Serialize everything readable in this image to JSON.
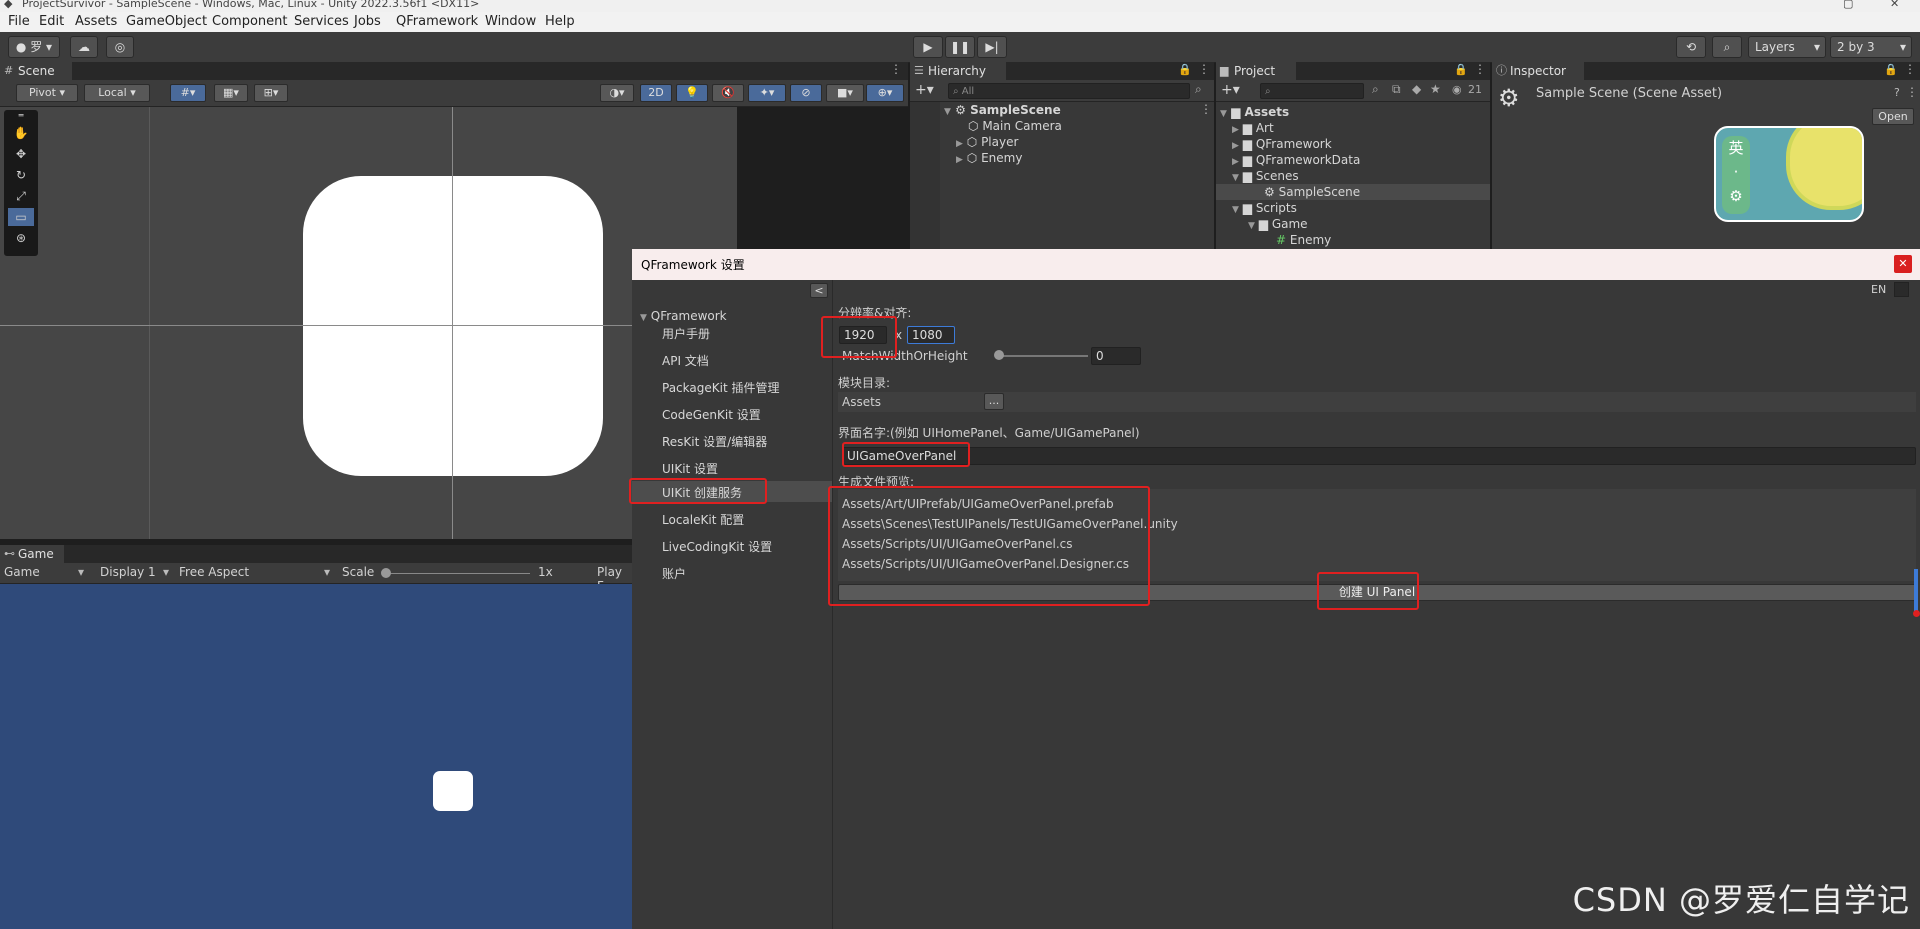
{
  "window": {
    "title": "ProjectSurvivor - SampleScene - Windows, Mac, Linux - Unity 2022.3.56f1 <DX11>"
  },
  "menu": [
    "File",
    "Edit",
    "Assets",
    "GameObject",
    "Component",
    "Services",
    "Jobs",
    "QFramework",
    "Window",
    "Help"
  ],
  "toolbar": {
    "account": "罗",
    "layers_label": "Layers",
    "layout_label": "2 by 3"
  },
  "scene": {
    "tab": "Scene",
    "pivot": "Pivot",
    "local": "Local",
    "mode_2d": "2D"
  },
  "game": {
    "tab": "Game",
    "display_mode": "Game",
    "display": "Display 1",
    "aspect": "Free Aspect",
    "scale_label": "Scale",
    "scale_value": "1x",
    "play_focus": "Play F"
  },
  "hierarchy": {
    "tab": "Hierarchy",
    "search_placeholder": "All",
    "scene_name": "SampleScene",
    "items": [
      "Main Camera",
      "Player",
      "Enemy"
    ]
  },
  "project": {
    "tab": "Project",
    "count": "21",
    "root": "Assets",
    "items": [
      "Art",
      "QFramework",
      "QFrameworkData",
      "Scenes",
      "SampleScene",
      "Scripts",
      "Game",
      "Enemy"
    ]
  },
  "inspector": {
    "tab": "Inspector",
    "asset_title": "Sample Scene (Scene Asset)",
    "open_button": "Open",
    "badge_char_1": "英",
    "badge_char_2": "·",
    "badge_gear": "⚙"
  },
  "qf": {
    "title": "QFramework 设置",
    "collapse_btn": "<",
    "en_label": "EN",
    "tree_root": "QFramework",
    "nav": [
      "用户手册",
      "API 文档",
      "PackageKit 插件管理",
      "CodeGenKit 设置",
      "ResKit 设置/编辑器",
      "UIKit 设置",
      "UIKit 创建服务",
      "LocaleKit 配置",
      "LiveCodingKit 设置",
      "账户"
    ],
    "resolution_label": "分辨率&对齐:",
    "res_width": "1920",
    "res_x": "x",
    "res_height": "1080",
    "match_label": "MatchWidthOrHeight",
    "match_value": "0",
    "match_fraction": 0,
    "module_dir_label": "模块目录:",
    "module_dir_value": "Assets",
    "browse_btn": "...",
    "panel_name_label": "界面名字:(例如 UIHomePanel、Game/UIGamePanel)",
    "panel_name_value": "UIGameOverPanel",
    "preview_label": "生成文件预览:",
    "preview_files": [
      "Assets/Art/UIPrefab/UIGameOverPanel.prefab",
      "Assets\\Scenes\\TestUIPanels/TestUIGameOverPanel.unity",
      "Assets/Scripts/UI/UIGameOverPanel.cs",
      "Assets/Scripts/UI/UIGameOverPanel.Designer.cs"
    ],
    "create_button": "创建 UI Panel"
  },
  "watermark": "CSDN @罗爱仁自学记"
}
